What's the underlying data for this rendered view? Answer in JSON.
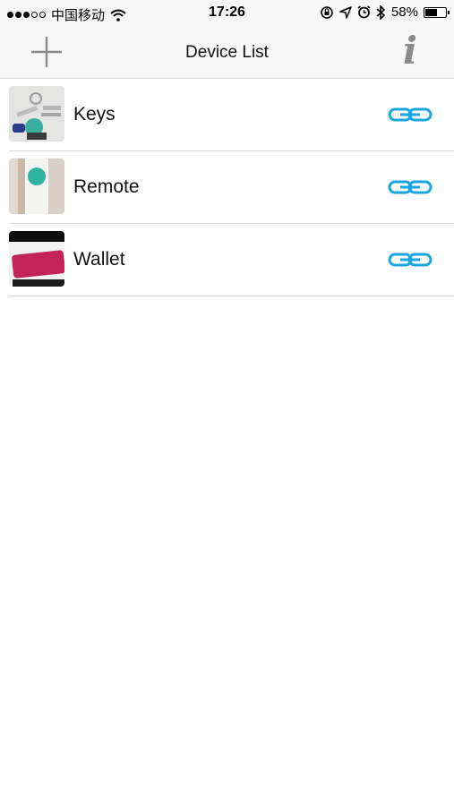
{
  "status_bar": {
    "carrier": "中国移动",
    "time": "17:26",
    "battery_percent": "58%",
    "battery_level": 0.58,
    "signal_bars_filled": 3,
    "signal_bars_total": 5
  },
  "nav": {
    "title": "Device List",
    "add_icon": "plus-icon",
    "info_label": "i"
  },
  "devices": [
    {
      "name": "Keys",
      "thumbnail": "keys-photo",
      "status_icon": "link-icon"
    },
    {
      "name": "Remote",
      "thumbnail": "remote-photo",
      "status_icon": "link-icon"
    },
    {
      "name": "Wallet",
      "thumbnail": "wallet-photo",
      "status_icon": "link-icon"
    }
  ],
  "colors": {
    "accent": "#1aa6e0",
    "bar_background": "#f7f7f7",
    "divider": "#d8d8d8",
    "info_icon": "#8a8a8a"
  }
}
